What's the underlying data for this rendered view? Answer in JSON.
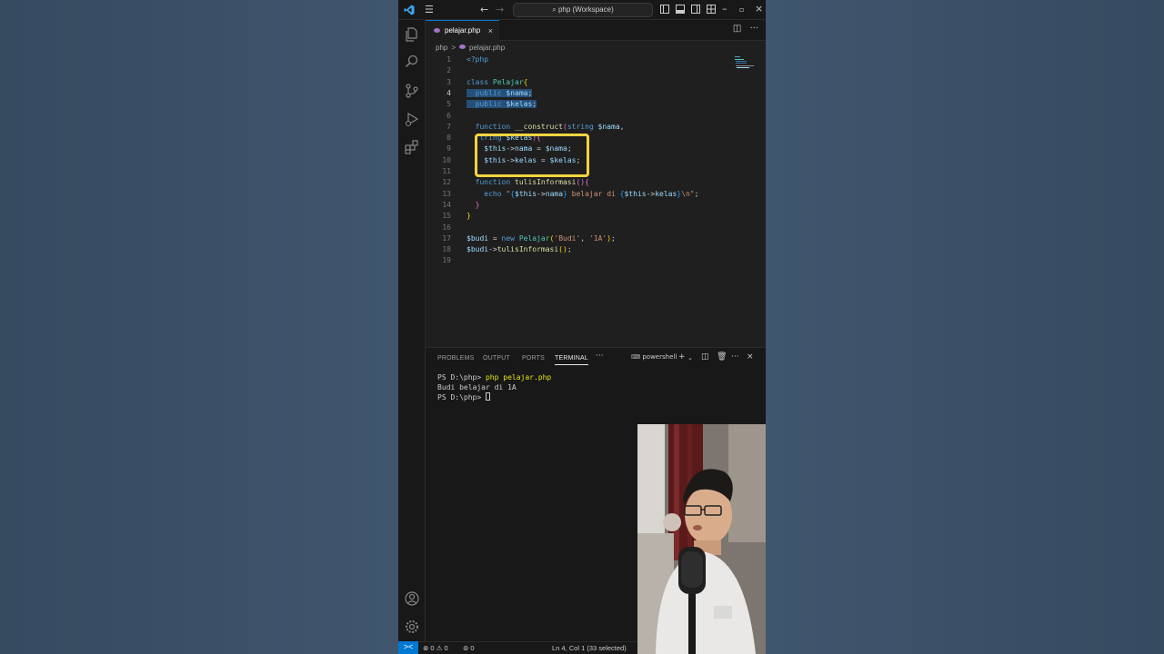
{
  "window": {
    "search_label": "php (Workspace)"
  },
  "tabs": [
    {
      "label": "pelajar.php",
      "close": "×"
    }
  ],
  "breadcrumb": {
    "folder": "php",
    "file": "pelajar.php",
    "sep": ">"
  },
  "editor": {
    "line_numbers": [
      "1",
      "2",
      "3",
      "4",
      "5",
      "6",
      "7",
      "8",
      "9",
      "10",
      "11",
      "12",
      "13",
      "14",
      "15",
      "16",
      "17",
      "18",
      "19"
    ]
  },
  "panel": {
    "tabs": [
      "PROBLEMS",
      "OUTPUT",
      "PORTS",
      "TERMINAL"
    ],
    "more": "···",
    "shell": "powershell",
    "terminal_lines": [
      "PS D:\\php> ",
      "Budi belajar di 1A",
      "PS D:\\php> "
    ],
    "command": "php pelajar.php"
  },
  "statusbar": {
    "remote": "><",
    "errors": "0",
    "warnings": "0",
    "ports": "0",
    "position": "Ln 4, Col 1 (33 selected)"
  },
  "colors": {
    "accent": "#0078d4",
    "highlight_box": "#f5d442",
    "selection": "#264f78"
  }
}
